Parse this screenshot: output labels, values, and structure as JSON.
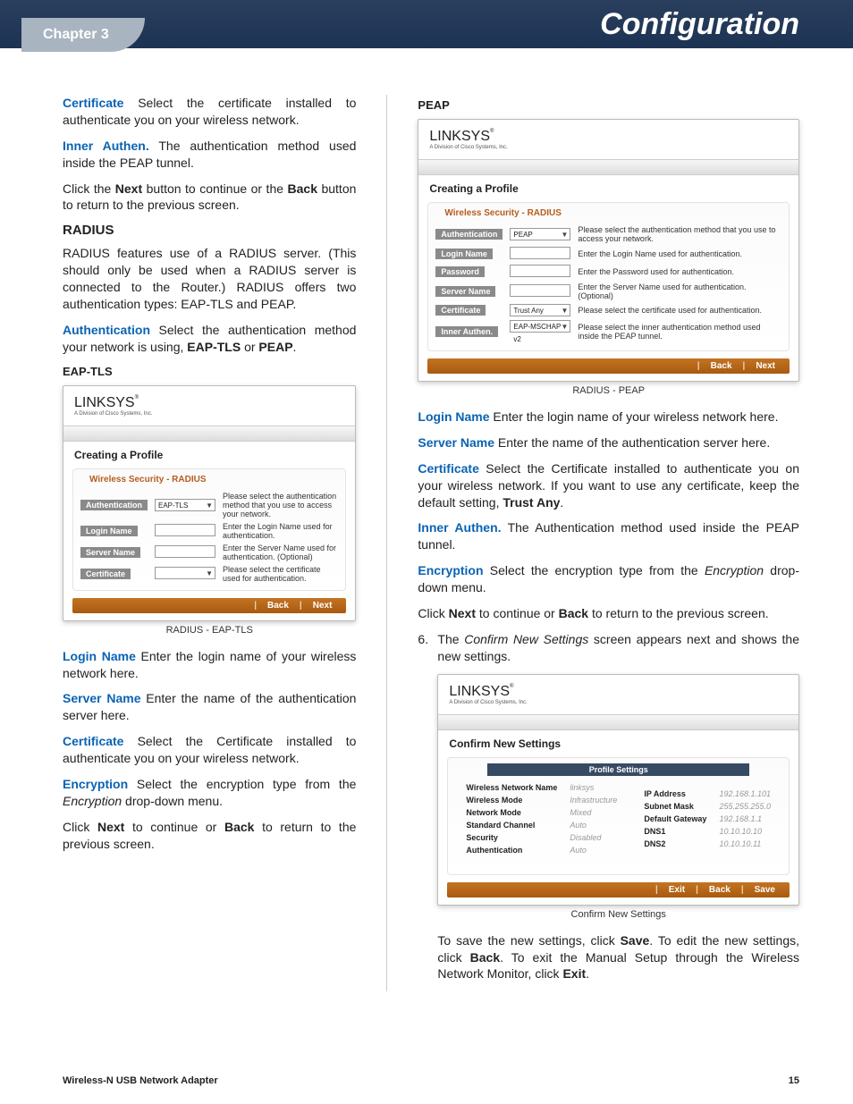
{
  "header": {
    "chapter": "Chapter 3",
    "title": "Configuration"
  },
  "footer": {
    "product": "Wireless-N USB Network Adapter",
    "page": "15"
  },
  "left": {
    "p1": {
      "term": "Certificate",
      "text": "  Select the certificate installed to authenticate you on your wireless network."
    },
    "p2": {
      "term": "Inner Authen.",
      "text": " The authentication method used inside the PEAP tunnel."
    },
    "p3": "Click the Next button to continue or the Back button to return to the previous screen.",
    "h_radius": "RADIUS",
    "p4": "RADIUS features use of a RADIUS server. (This should only be used when a RADIUS server is connected to the Router.) RADIUS offers two authentication types: EAP-TLS and PEAP.",
    "p5": {
      "term": "Authentication",
      "text": " Select the authentication method your network is using, EAP-TLS or PEAP."
    },
    "h_eaptls": "EAP-TLS",
    "fig1cap": "RADIUS - EAP-TLS",
    "p6": {
      "term": "Login Name",
      "text": " Enter the login name of your wireless network here."
    },
    "p7": {
      "term": "Server Name",
      "text": " Enter the name of the authentication server here."
    },
    "p8": {
      "term": "Certificate",
      "text": "  Select the Certificate installed to authenticate you on your wireless network."
    },
    "p9": {
      "term": "Encryption",
      "text": " Select the encryption type from the Encryption drop-down menu."
    },
    "p10": "Click Next to continue or Back to return to the previous screen."
  },
  "right": {
    "h_peap": "PEAP",
    "fig2cap": "RADIUS - PEAP",
    "p1": {
      "term": "Login Name",
      "text": " Enter the login name of your wireless network here."
    },
    "p2": {
      "term": "Server Name",
      "text": " Enter the name of the authentication server here."
    },
    "p3": {
      "term": "Certificate",
      "text": "  Select the Certificate installed to authenticate you on your wireless network.  If you want to use any certificate, keep the default setting, Trust Any."
    },
    "p4": {
      "term": "Inner Authen.",
      "text": " The Authentication method used inside the PEAP tunnel."
    },
    "p5": {
      "term": "Encryption",
      "text": " Select the encryption type from the Encryption drop-down menu."
    },
    "p6": "Click Next to continue or Back to return to the previous screen.",
    "step6": "The Confirm New Settings screen appears next and shows the new settings.",
    "fig3cap": "Confirm New Settings",
    "p7": "To save the new settings, click Save. To edit the new settings, click Back. To exit the Manual Setup through the Wireless Network Monitor, click Exit."
  },
  "card_common": {
    "logo": "LINKSYS",
    "sublogo": "A Division of Cisco Systems, Inc.",
    "creating": "Creating a Profile",
    "confirm": "Confirm New Settings",
    "subhdr": "Wireless Security - RADIUS",
    "back": "Back",
    "next": "Next",
    "exit": "Exit",
    "save": "Save"
  },
  "card_eaptls": {
    "rows": [
      {
        "label": "Authentication",
        "val": "EAP-TLS",
        "dd": true,
        "hint": "Please select the authentication method that you use to access your network."
      },
      {
        "label": "Login Name",
        "val": "",
        "dd": false,
        "hint": "Enter the Login Name used for authentication."
      },
      {
        "label": "Server Name",
        "val": "",
        "dd": false,
        "hint": "Enter the Server Name used for authentication. (Optional)"
      },
      {
        "label": "Certificate",
        "val": "",
        "dd": true,
        "hint": "Please select the certificate used for authentication."
      }
    ]
  },
  "card_peap": {
    "rows": [
      {
        "label": "Authentication",
        "val": "PEAP",
        "dd": true,
        "hint": "Please select the authentication method that you use to access your network."
      },
      {
        "label": "Login Name",
        "val": "",
        "dd": false,
        "hint": "Enter the Login Name used for authentication."
      },
      {
        "label": "Password",
        "val": "",
        "dd": false,
        "hint": "Enter the Password used for authentication."
      },
      {
        "label": "Server Name",
        "val": "",
        "dd": false,
        "hint": "Enter the Server Name used for authentication. (Optional)"
      },
      {
        "label": "Certificate",
        "val": "Trust Any",
        "dd": true,
        "hint": "Please select the certificate used for authentication."
      },
      {
        "label": "Inner Authen.",
        "val": "EAP-MSCHAP v2",
        "dd": true,
        "hint": "Please select the inner authentication method used inside the PEAP tunnel."
      }
    ]
  },
  "card_confirm": {
    "heading": "Profile Settings",
    "left": [
      {
        "k": "Wireless Network Name",
        "v": "linksys"
      },
      {
        "k": "Wireless Mode",
        "v": "Infrastructure"
      },
      {
        "k": "Network Mode",
        "v": "Mixed"
      },
      {
        "k": "Standard Channel",
        "v": "Auto"
      },
      {
        "k": "Security",
        "v": "Disabled"
      },
      {
        "k": "Authentication",
        "v": "Auto"
      }
    ],
    "right": [
      {
        "k": "IP Address",
        "v": "192.168.1.101"
      },
      {
        "k": "Subnet Mask",
        "v": "255.255.255.0"
      },
      {
        "k": "Default Gateway",
        "v": "192.168.1.1"
      },
      {
        "k": "DNS1",
        "v": "10.10.10.10"
      },
      {
        "k": "DNS2",
        "v": "10.10.10.11"
      }
    ]
  }
}
